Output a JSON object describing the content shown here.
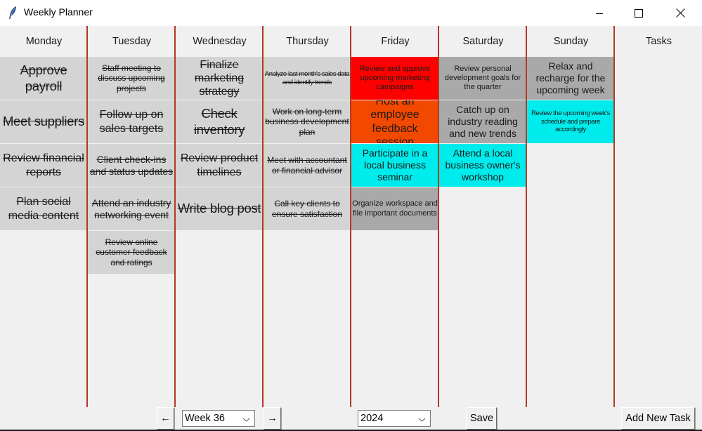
{
  "window": {
    "title": "Weekly Planner",
    "icon": "feather-icon",
    "controls": [
      "minimize",
      "maximize",
      "close"
    ]
  },
  "columns": [
    {
      "day": "Monday",
      "tasks": [
        {
          "text": "Approve payroll",
          "done": true,
          "color": "#d4d4d4"
        },
        {
          "text": "Meet suppliers",
          "done": true,
          "color": "#d4d4d4"
        },
        {
          "text": "Review financial reports",
          "done": true,
          "color": "#d4d4d4"
        },
        {
          "text": "Plan social media content",
          "done": true,
          "color": "#d4d4d4"
        }
      ]
    },
    {
      "day": "Tuesday",
      "tasks": [
        {
          "text": "Staff meeting to discuss upcoming projects",
          "done": true,
          "color": "#d4d4d4"
        },
        {
          "text": "Follow up on sales targets",
          "done": true,
          "color": "#d4d4d4"
        },
        {
          "text": "Client check-ins and status updates",
          "done": true,
          "color": "#d4d4d4"
        },
        {
          "text": "Attend an industry networking event",
          "done": true,
          "color": "#d4d4d4"
        },
        {
          "text": "Review online customer feedback and ratings",
          "done": true,
          "color": "#d4d4d4"
        }
      ]
    },
    {
      "day": "Wednesday",
      "tasks": [
        {
          "text": "Finalize marketing strategy",
          "done": true,
          "color": "#d4d4d4"
        },
        {
          "text": "Check inventory",
          "done": true,
          "color": "#d4d4d4"
        },
        {
          "text": "Review product timelines",
          "done": true,
          "color": "#d4d4d4"
        },
        {
          "text": "Write blog post",
          "done": true,
          "color": "#d4d4d4"
        }
      ]
    },
    {
      "day": "Thursday",
      "tasks": [
        {
          "text": "Analyze last month's sales data and identify trends",
          "done": true,
          "color": "#d4d4d4"
        },
        {
          "text": "Work on long-term business development plan",
          "done": true,
          "color": "#d4d4d4"
        },
        {
          "text": "Meet with accountant or financial advisor",
          "done": true,
          "color": "#d4d4d4"
        },
        {
          "text": "Call key clients to ensure satisfaction",
          "done": true,
          "color": "#d4d4d4"
        }
      ]
    },
    {
      "day": "Friday",
      "tasks": [
        {
          "text": "Review and approve upcoming marketing campaigns",
          "done": false,
          "color": "#ff0000"
        },
        {
          "text": "Host an employee feedback session",
          "done": false,
          "color": "#f24800"
        },
        {
          "text": "Participate in a local business seminar",
          "done": false,
          "color": "#00ecec"
        },
        {
          "text": "Organize workspace and file important documents",
          "done": false,
          "color": "#a9a9a9"
        }
      ]
    },
    {
      "day": "Saturday",
      "tasks": [
        {
          "text": "Review personal development goals for the quarter",
          "done": false,
          "color": "#a9a9a9"
        },
        {
          "text": "Catch up on industry reading and new trends",
          "done": false,
          "color": "#a9a9a9"
        },
        {
          "text": "Attend a local business owner's workshop",
          "done": false,
          "color": "#00ecec"
        }
      ]
    },
    {
      "day": "Sunday",
      "tasks": [
        {
          "text": "Relax and recharge for the upcoming week",
          "done": false,
          "color": "#a9a9a9"
        },
        {
          "text": "Review the upcoming week's schedule and prepare accordingly",
          "done": false,
          "color": "#00ecec"
        }
      ]
    },
    {
      "day": "Tasks",
      "tasks": []
    }
  ],
  "controls": {
    "prev_label": "←",
    "week_value": "Week 36",
    "next_label": "→",
    "year_value": "2024",
    "save_label": "Save",
    "add_task_label": "Add New Task"
  },
  "colors": {
    "separator": "#b23a22",
    "done_cell": "#d4d4d4",
    "neutral_cell": "#a9a9a9",
    "urgent": "#ff0000",
    "high": "#f24800",
    "event": "#00ecec"
  }
}
